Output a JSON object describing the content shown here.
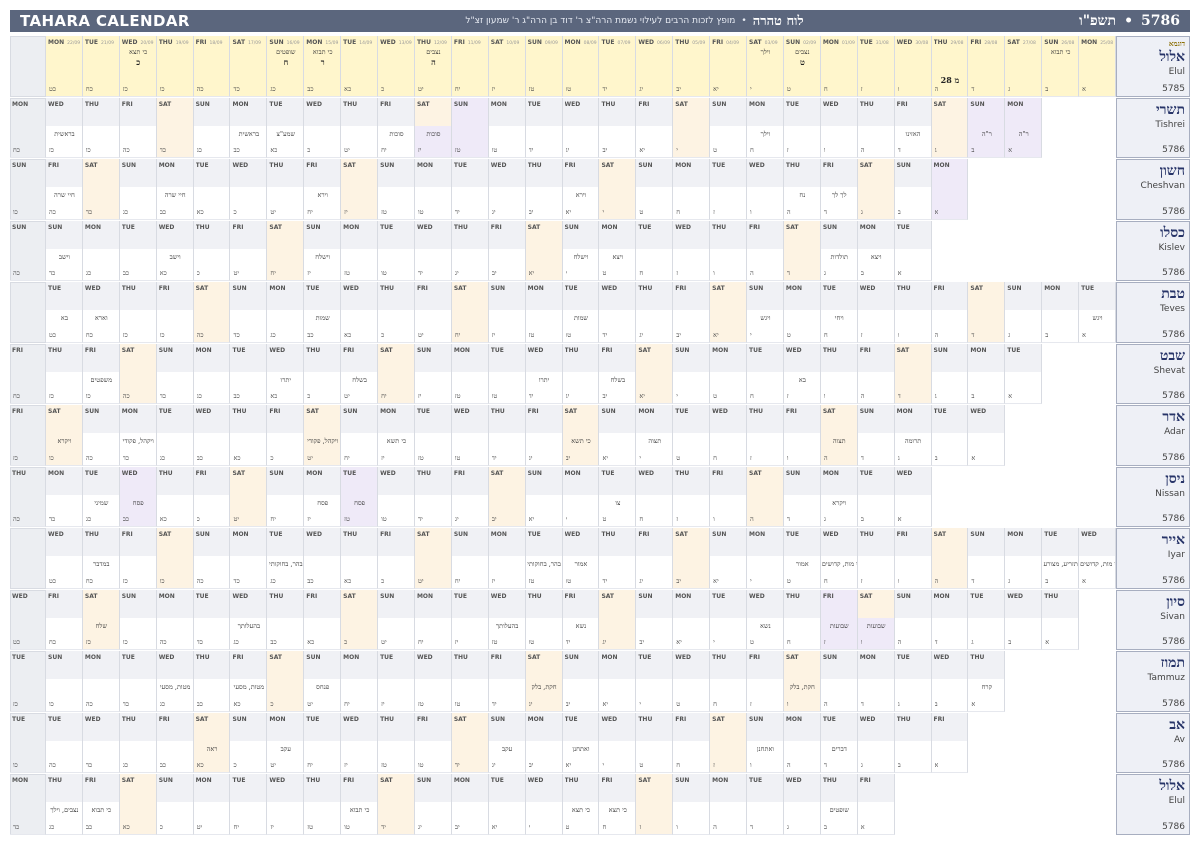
{
  "header": {
    "title": "TAHARA CALENDAR",
    "sub_title": "לוח טהרה",
    "dedication": "מופץ לזכות הרבים לעילוי נשמת הרה\"צ ר' דוד בן הרה\"ג ר' שמעון זצ\"ל",
    "year_num": "5786",
    "year_heb": "תשפ\"ו"
  },
  "sample_tag": "דוגמא",
  "sample_day_label": "28 מ",
  "colors": {
    "sat": "#fdf3e3",
    "fri": "#ffffff",
    "rh": "#efeaf8",
    "sample": "#fff6cc",
    "head": "#f0f1f5"
  },
  "months": [
    {
      "heb": "אלול",
      "eng": "Elul",
      "year": "5785",
      "start": 0,
      "length": 29,
      "sample": true,
      "parsha": {
        "26": "כי תצא",
        "22": "שופטים",
        "21": "כי תבוא",
        "18": "נצבים",
        "1": "כי תבוא",
        "8": "נצבים",
        "9": "וילך"
      },
      "special": {
        "8": "ט",
        "18": "ה",
        "21": "ר",
        "22": "ח",
        "26": "כ"
      }
    },
    {
      "heb": "תשרי",
      "eng": "Tishrei",
      "year": "5786",
      "start": 2,
      "length": 30,
      "parsha": {
        "0": "ר\"ה",
        "1": "ר\"ה",
        "3": "האזינו",
        "7": "וילך",
        "16": "סוכות",
        "17": "סוכות",
        "20": "שמע\"צ",
        "21": "בראשית",
        "26": "בראשית",
        "28": "נח"
      },
      "rh": [
        0,
        1,
        15,
        16,
        29
      ]
    },
    {
      "heb": "חשון",
      "eng": "Cheshvan",
      "year": "5786",
      "start": 4,
      "length": 29,
      "parsha": {
        "3": "לך לך",
        "4": "נח",
        "10": "וירא",
        "17": "וירא",
        "24": "חיי שרה",
        "29": "תולדות",
        "21": "חיי שרה"
      },
      "rh": [
        0
      ]
    },
    {
      "heb": "כסלו",
      "eng": "Kislev",
      "year": "5786",
      "start": 5,
      "length": 30,
      "parsha": {
        "1": "ויצא",
        "2": "תולדות",
        "8": "ויצא",
        "9": "וישלח",
        "16": "וישלח",
        "20": "וישב",
        "23": "וישב",
        "24": "מקץ",
        "29": "מקץ"
      },
      "rh": []
    },
    {
      "heb": "טבת",
      "eng": "Teves",
      "year": "5786",
      "start": 0,
      "length": 29,
      "parsha": {
        "0": "ויגש",
        "7": "ויחי",
        "9": "ויגש",
        "14": "שמות",
        "21": "שמות",
        "27": "וארא",
        "28": "בא"
      },
      "rh": []
    },
    {
      "heb": "שבט",
      "eng": "Shevat",
      "year": "5786",
      "start": 2,
      "length": 30,
      "parsha": {
        "6": "בא",
        "11": "בשלח",
        "18": "בשלח",
        "13": "יתרו",
        "20": "יתרו",
        "25": "משפטים",
        "27": "משפטים",
        "29": "תרומה"
      },
      "rh": []
    },
    {
      "heb": "אדר",
      "eng": "Adar",
      "year": "5786",
      "start": 3,
      "length": 29,
      "parsha": {
        "2": "תרומה",
        "4": "תצוה",
        "9": "תצוה",
        "11": "כי תשא",
        "16": "כי תשא",
        "18": "ויקהל, פקודי",
        "23": "ויקהל, פקודי",
        "25": "ויקרא"
      },
      "rh": []
    },
    {
      "heb": "ניסן",
      "eng": "Nissan",
      "year": "5786",
      "start": 5,
      "length": 30,
      "parsha": {
        "2": "ויקרא",
        "8": "צו",
        "15": "פסח",
        "16": "פסח",
        "21": "פסח",
        "22": "שמיני",
        "24": "שמיני",
        "26": "תזריע, מצורע"
      },
      "rh": [
        15,
        21
      ]
    },
    {
      "heb": "אייר",
      "eng": "Iyar",
      "year": "5786",
      "start": 0,
      "length": 29,
      "parsha": {
        "0": "אחרי מות, קדושים",
        "1": "תזריע, מצורע",
        "7": "אחרי מות, קדושים",
        "8": "אמור",
        "14": "אמור",
        "15": "בהר, בחוקותי",
        "22": "בהר, בחוקותי",
        "27": "במדבר",
        "29": "במדבר"
      },
      "rh": []
    },
    {
      "heb": "סיון",
      "eng": "Sivan",
      "year": "5786",
      "start": 1,
      "length": 30,
      "parsha": {
        "5": "שבועות",
        "6": "שבועות",
        "8": "נשא",
        "13": "נשא",
        "15": "בהעלותך",
        "22": "בהעלותך",
        "26": "שלח",
        "29": "קרח"
      },
      "rh": [
        5,
        6
      ]
    },
    {
      "heb": "תמוז",
      "eng": "Tammuz",
      "year": "5786",
      "start": 3,
      "length": 29,
      "parsha": {
        "0": "קרח",
        "5": "חקת, בלק",
        "12": "חקת, בלק",
        "18": "פנחס",
        "20": "מטות, מסעי",
        "22": "מטות, מסעי",
        "27": "דברים"
      },
      "rh": []
    },
    {
      "heb": "אב",
      "eng": "Av",
      "year": "5786",
      "start": 4,
      "length": 30,
      "parsha": {
        "3": "דברים",
        "5": "ואתחנן",
        "10": "ואתחנן",
        "12": "עקב",
        "18": "עקב",
        "20": "ראה",
        "26": "ראה",
        "29": "שופטים"
      },
      "rh": []
    },
    {
      "heb": "אלול",
      "eng": "Elul",
      "year": "5786",
      "start": 6,
      "length": 29,
      "parsha": {
        "1": "שופטים",
        "7": "כי תצא",
        "8": "כי תצא",
        "14": "כי תבוא",
        "21": "כי תבוא",
        "22": "נצבים, וילך",
        "28": "נצבים, וילך"
      },
      "rh": []
    }
  ],
  "sample_greg": {
    "days": [
      "25/08",
      "26/08",
      "27/08",
      "28/08",
      "29/08",
      "30/08",
      "31/08",
      "01/09",
      "02/09",
      "03/09",
      "04/09",
      "05/09",
      "06/09",
      "07/09",
      "08/09",
      "09/09",
      "10/09",
      "11/09",
      "12/09",
      "13/09",
      "14/09",
      "15/09",
      "16/09",
      "17/09",
      "18/09",
      "19/09",
      "20/09",
      "21/09",
      "22/09"
    ]
  },
  "dows": [
    "MON",
    "TUE",
    "WED",
    "THU",
    "FRI",
    "SAT",
    "SUN"
  ],
  "hebnums": [
    "א",
    "ב",
    "ג",
    "ד",
    "ה",
    "ו",
    "ז",
    "ח",
    "ט",
    "י",
    "יא",
    "יב",
    "יג",
    "יד",
    "טו",
    "טז",
    "יז",
    "יח",
    "יט",
    "כ",
    "כא",
    "כב",
    "כג",
    "כד",
    "כה",
    "כו",
    "כז",
    "כח",
    "כט",
    "ל"
  ]
}
